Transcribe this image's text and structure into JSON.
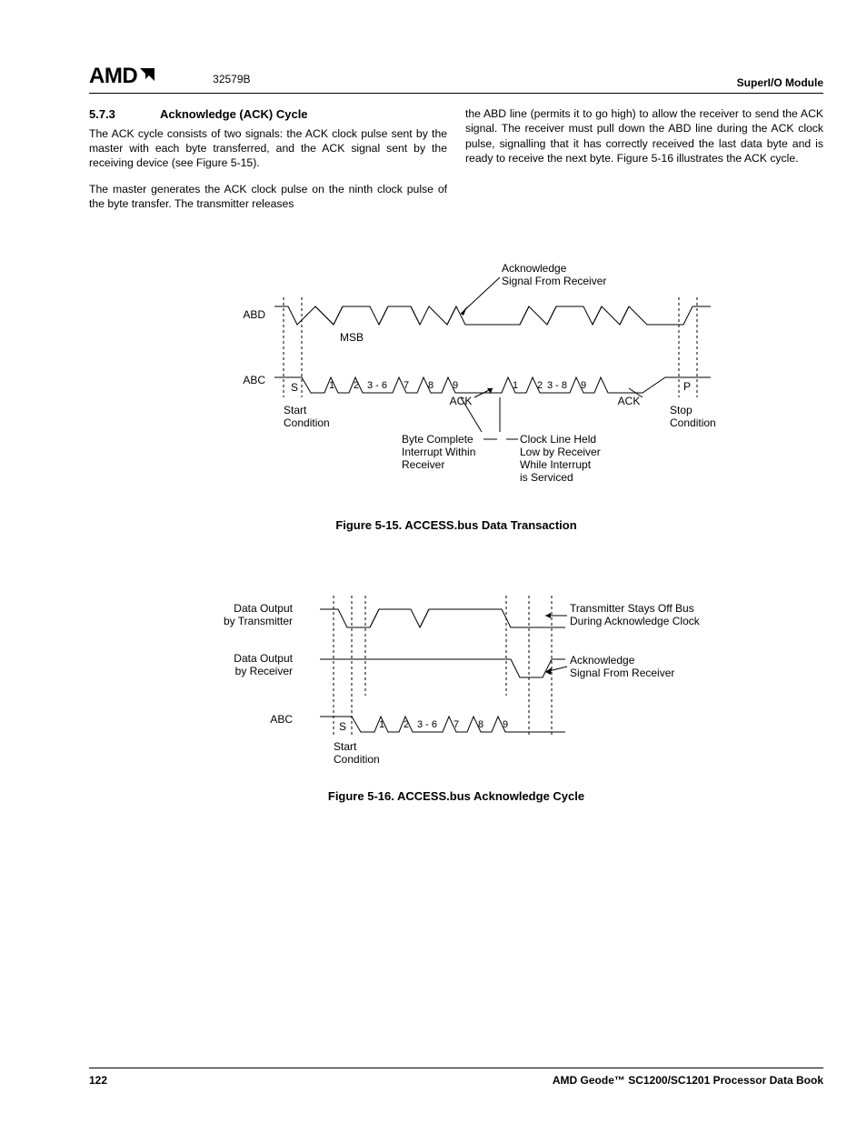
{
  "header": {
    "logo_text": "AMD",
    "doc_number": "32579B",
    "right_text": "SuperI/O Module"
  },
  "section": {
    "number": "5.7.3",
    "title": "Acknowledge (ACK) Cycle"
  },
  "body": {
    "col1_p1": "The ACK cycle consists of two signals: the ACK clock pulse sent by the master with each byte transferred, and the ACK signal sent by the receiving device (see Figure 5-15).",
    "col1_p2": "The master generates the ACK clock pulse on the ninth clock pulse of the byte transfer. The transmitter releases",
    "col2_p1": "the ABD line (permits it to go high) to allow the receiver to send the ACK signal. The receiver must pull down the ABD line during the ACK clock pulse, signalling that it has correctly received the last data byte and is ready to receive the next byte. Figure 5-16 illustrates the ACK cycle."
  },
  "figure15": {
    "caption": "Figure 5-15.  ACCESS.bus Data Transaction",
    "labels": {
      "ack_signal": "Acknowledge",
      "ack_signal2": "Signal From Receiver",
      "abd": "ABD",
      "msb": "MSB",
      "abc": "ABC",
      "s": "S",
      "start1": "Start",
      "start2": "Condition",
      "byte_complete1": "Byte Complete",
      "byte_complete2": "Interrupt Within",
      "byte_complete3": "Receiver",
      "clock_held1": "Clock Line Held",
      "clock_held2": "Low by Receiver",
      "clock_held3": "While Interrupt",
      "clock_held4": "is Serviced",
      "ack": "ACK",
      "p": "P",
      "stop1": "Stop",
      "stop2": "Condition",
      "ticks_group1": [
        "1",
        "2",
        "3 - 6",
        "7",
        "8",
        "9"
      ],
      "ticks_group2": [
        "1",
        "2",
        "3 - 8",
        "9"
      ]
    }
  },
  "figure16": {
    "caption": "Figure 5-16.  ACCESS.bus Acknowledge Cycle",
    "labels": {
      "dot1a": "Data Output",
      "dot1b": "by Transmitter",
      "dot2a": "Data Output",
      "dot2b": "by Receiver",
      "abc": "ABC",
      "s": "S",
      "start1": "Start",
      "start2": "Condition",
      "tx_stays1": "Transmitter Stays Off Bus",
      "tx_stays2": "During Acknowledge Clock",
      "ack1": "Acknowledge",
      "ack2": "Signal From Receiver",
      "ticks": [
        "1",
        "2",
        "3 - 6",
        "7",
        "8",
        "9"
      ]
    }
  },
  "footer": {
    "page_number": "122",
    "book_title": "AMD Geode™ SC1200/SC1201 Processor Data Book"
  }
}
